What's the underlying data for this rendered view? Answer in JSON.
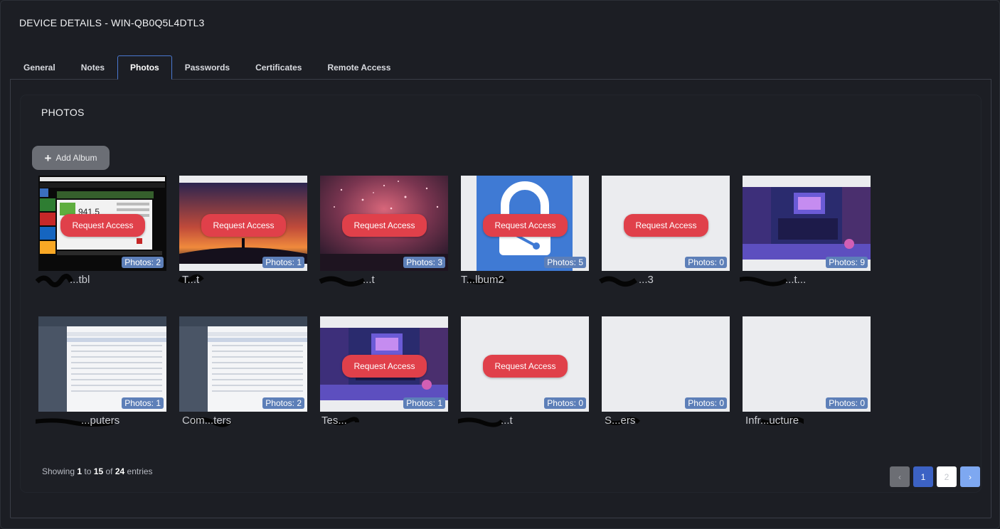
{
  "window": {
    "title": "DEVICE DETAILS - WIN-QB0Q5L4DTL3"
  },
  "tabs": [
    {
      "label": "General",
      "active": false
    },
    {
      "label": "Notes",
      "active": false
    },
    {
      "label": "Photos",
      "active": true
    },
    {
      "label": "Passwords",
      "active": false
    },
    {
      "label": "Certificates",
      "active": false
    },
    {
      "label": "Remote Access",
      "active": false
    }
  ],
  "photos": {
    "heading": "PHOTOS",
    "add_album_label": "Add Album",
    "request_label": "Request Access",
    "albums": [
      {
        "thumb": "passmark-screenshot",
        "count": "Photos: 2",
        "locked": true,
        "name_visible": "...tbl"
      },
      {
        "thumb": "sunset-figure",
        "count": "Photos: 1",
        "locked": true,
        "name_visible": "T...t"
      },
      {
        "thumb": "fireworks",
        "count": "Photos: 3",
        "locked": true,
        "name_visible": "...t"
      },
      {
        "thumb": "lock-icon",
        "count": "Photos: 5",
        "locked": true,
        "name_visible": "T...lbum2"
      },
      {
        "thumb": "blank",
        "count": "Photos: 0",
        "locked": true,
        "name_visible": "...3"
      },
      {
        "thumb": "gaming-room",
        "count": "Photos: 9",
        "locked": false,
        "name_visible": "...t..."
      },
      {
        "thumb": "table-screenshot",
        "count": "Photos: 1",
        "locked": false,
        "name_visible": "...puters"
      },
      {
        "thumb": "table-screenshot",
        "count": "Photos: 2",
        "locked": false,
        "name_visible": "Com...ters"
      },
      {
        "thumb": "gaming-room",
        "count": "Photos: 1",
        "locked": true,
        "name_visible": "Tes..."
      },
      {
        "thumb": "blank",
        "count": "Photos: 0",
        "locked": true,
        "name_visible": "...t"
      },
      {
        "thumb": "blank",
        "count": "Photos: 0",
        "locked": false,
        "name_visible": "S...ers"
      },
      {
        "thumb": "blank",
        "count": "Photos: 0",
        "locked": false,
        "name_visible": "Infr...ucture"
      }
    ]
  },
  "pagination": {
    "showing_prefix": "Showing",
    "from": "1",
    "to_word": "to",
    "to": "15",
    "of_word": "of",
    "total": "24",
    "suffix": "entries",
    "pages": [
      "1",
      "2"
    ],
    "prev_icon": "chevron-left-icon",
    "next_icon": "chevron-right-icon"
  },
  "colors": {
    "background": "#1c1e24",
    "accent": "#3c62c4",
    "request_button": "#e0404a",
    "badge": "#5d7fb8"
  }
}
